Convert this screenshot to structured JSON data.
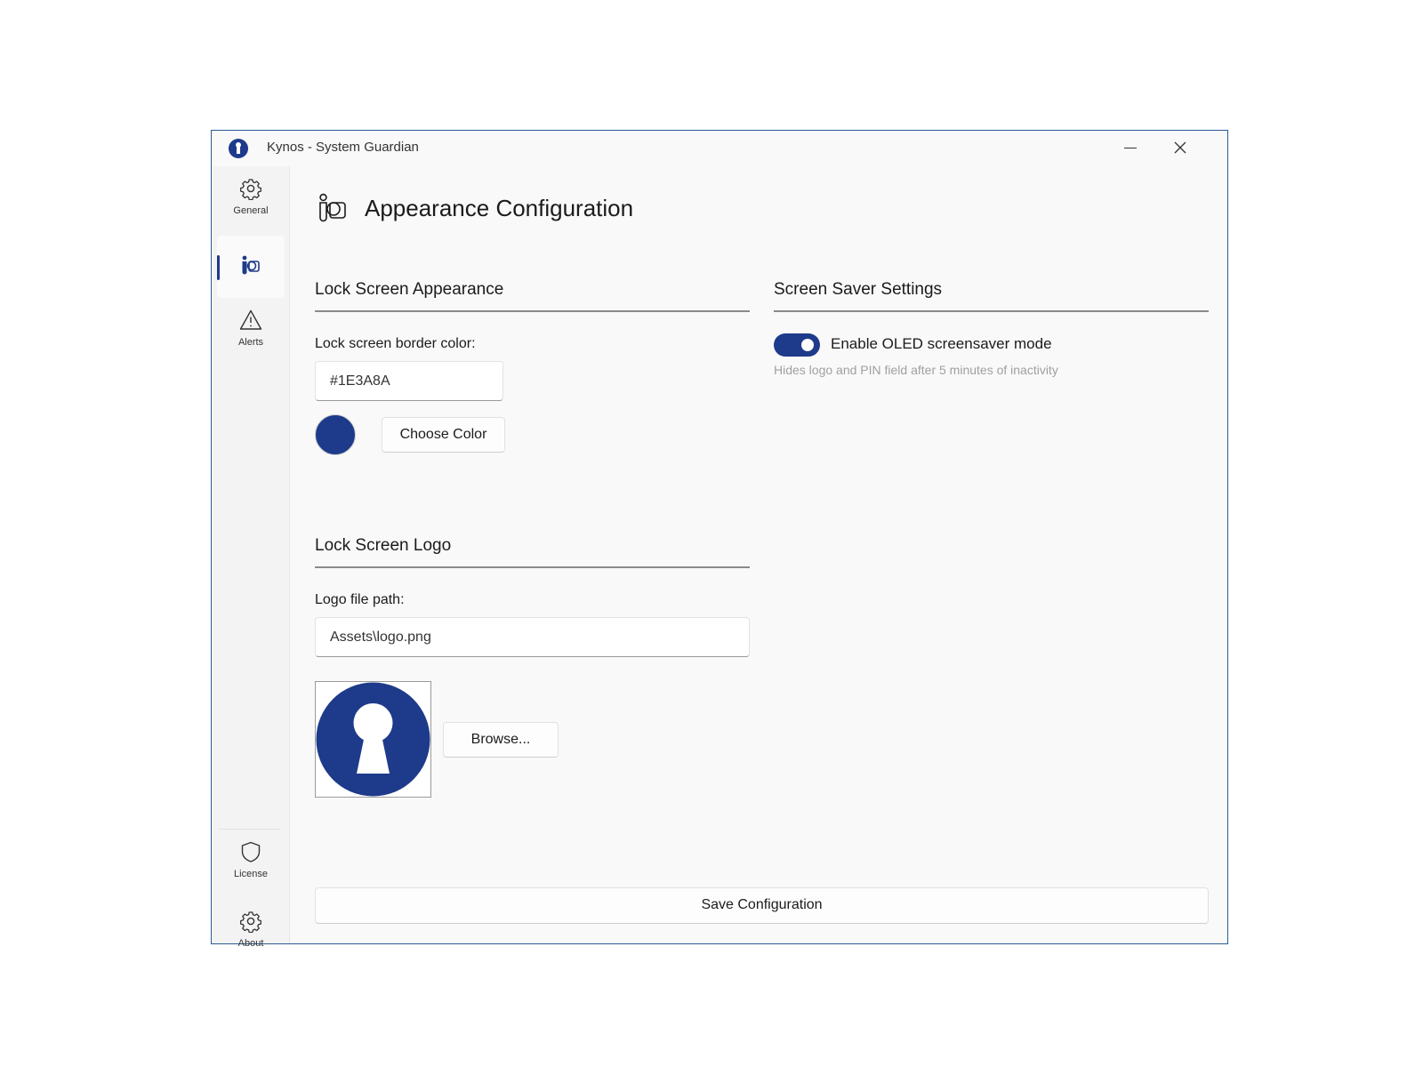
{
  "window": {
    "title": "Kynos - System Guardian",
    "accent_color": "#1E3A8A"
  },
  "sidebar": {
    "items": [
      {
        "label": "General",
        "icon": "gear-icon"
      },
      {
        "label": "",
        "icon": "appearance-icon",
        "active": true
      },
      {
        "label": "Alerts",
        "icon": "warning-icon"
      }
    ],
    "footer_items": [
      {
        "label": "License",
        "icon": "shield-icon"
      },
      {
        "label": "About",
        "icon": "gear-icon"
      }
    ]
  },
  "page": {
    "title": "Appearance Configuration",
    "icon": "appearance-icon"
  },
  "lock_screen_appearance": {
    "header": "Lock Screen Appearance",
    "border_color_label": "Lock screen border color:",
    "border_color_value": "#1E3A8A",
    "choose_color_label": "Choose Color"
  },
  "lock_screen_logo": {
    "header": "Lock Screen Logo",
    "path_label": "Logo file path:",
    "path_value": "Assets\\logo.png",
    "browse_label": "Browse...",
    "preview_icon": "keyhole-logo"
  },
  "screen_saver": {
    "header": "Screen Saver Settings",
    "toggle_label": "Enable OLED screensaver mode",
    "toggle_on": true,
    "hint": "Hides logo and PIN field after 5 minutes of inactivity"
  },
  "footer": {
    "save_label": "Save Configuration"
  }
}
